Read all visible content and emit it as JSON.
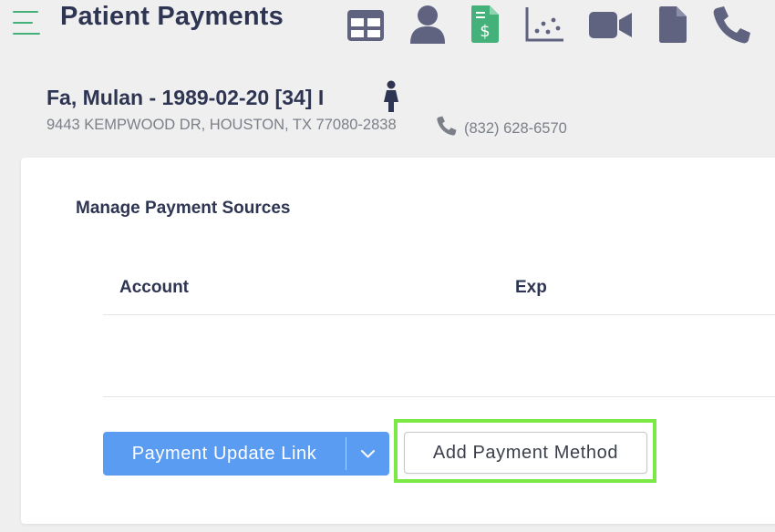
{
  "header": {
    "title": "Patient Payments",
    "menu_icon": "hamburger-menu-icon",
    "toolbar_icons": [
      "table-icon",
      "user-icon",
      "invoice-dollar-icon",
      "scatter-chart-icon",
      "video-camera-icon",
      "document-icon",
      "phone-icon"
    ]
  },
  "patient": {
    "name_line": "Fa, Mulan - 1989-02-20 [34] I",
    "gender_icon": "female-person-icon",
    "address": "9443 KEMPWOOD DR, HOUSTON, TX 77080-2838",
    "phone_icon": "phone-icon",
    "phone": "(832) 628-6570"
  },
  "payment_sources": {
    "title": "Manage Payment Sources",
    "columns": [
      "Account",
      "Exp"
    ],
    "rows": []
  },
  "actions": {
    "payment_update_link_label": "Payment Update Link",
    "dropdown_icon": "chevron-down-icon",
    "add_payment_method_label": "Add Payment Method"
  },
  "colors": {
    "accent_green": "#44b07a",
    "highlight_green": "#7be846",
    "primary_blue": "#5b9cf3",
    "icon_slate": "#5f6380",
    "title_navy": "#2e3552"
  }
}
